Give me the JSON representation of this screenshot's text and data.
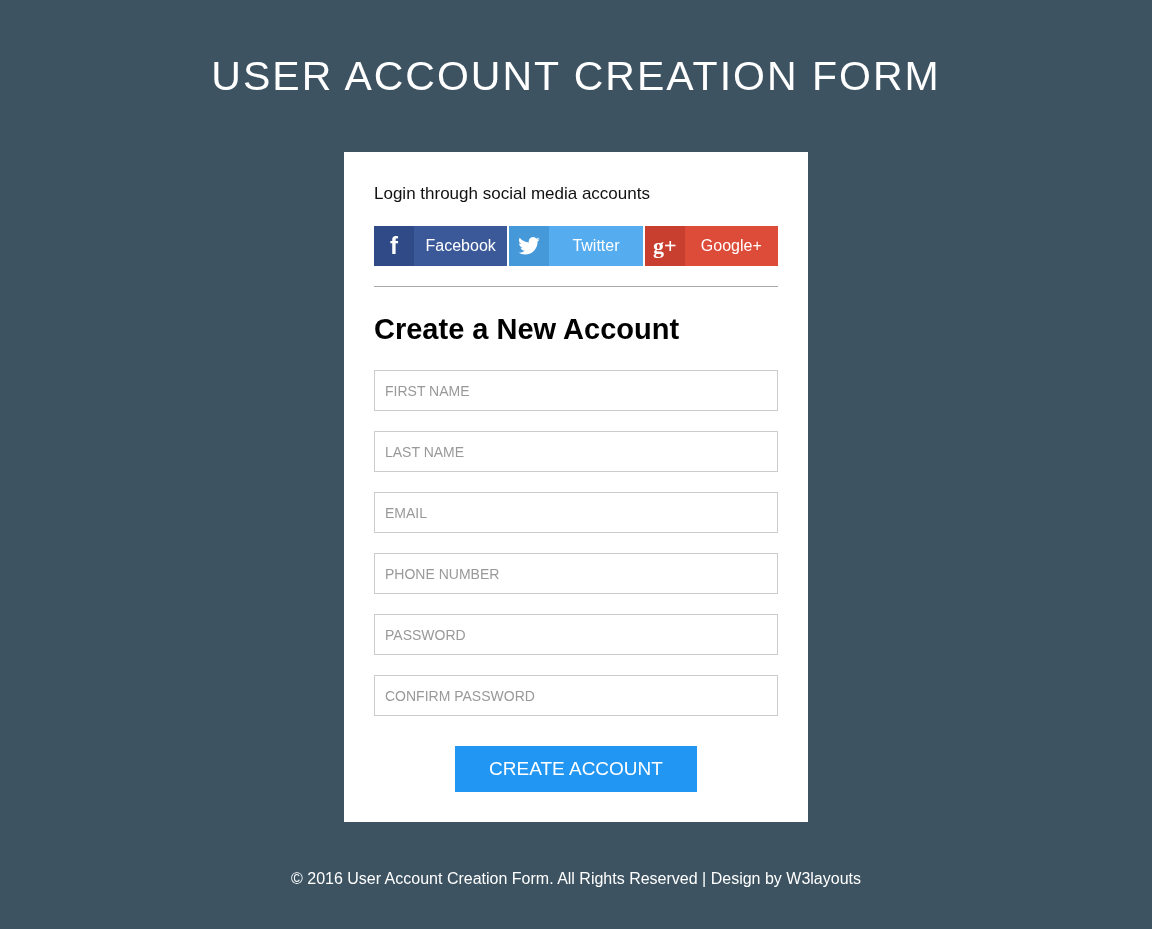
{
  "title": "USER ACCOUNT CREATION FORM",
  "social": {
    "heading": "Login through social media accounts",
    "buttons": [
      {
        "kind": "facebook",
        "glyph": "f",
        "label": "Facebook"
      },
      {
        "kind": "twitter",
        "label": "Twitter"
      },
      {
        "kind": "google",
        "glyph": "g+",
        "label": "Google+"
      }
    ]
  },
  "form": {
    "heading": "Create a New Account",
    "fields": [
      {
        "placeholder": "FIRST NAME"
      },
      {
        "placeholder": "LAST NAME"
      },
      {
        "placeholder": "EMAIL"
      },
      {
        "placeholder": "PHONE NUMBER"
      },
      {
        "placeholder": "PASSWORD"
      },
      {
        "placeholder": "CONFIRM PASSWORD"
      }
    ],
    "submit": "CREATE ACCOUNT"
  },
  "footer": {
    "text": "© 2016 User Account Creation Form. All Rights Reserved | Design by ",
    "link": "W3layouts"
  }
}
